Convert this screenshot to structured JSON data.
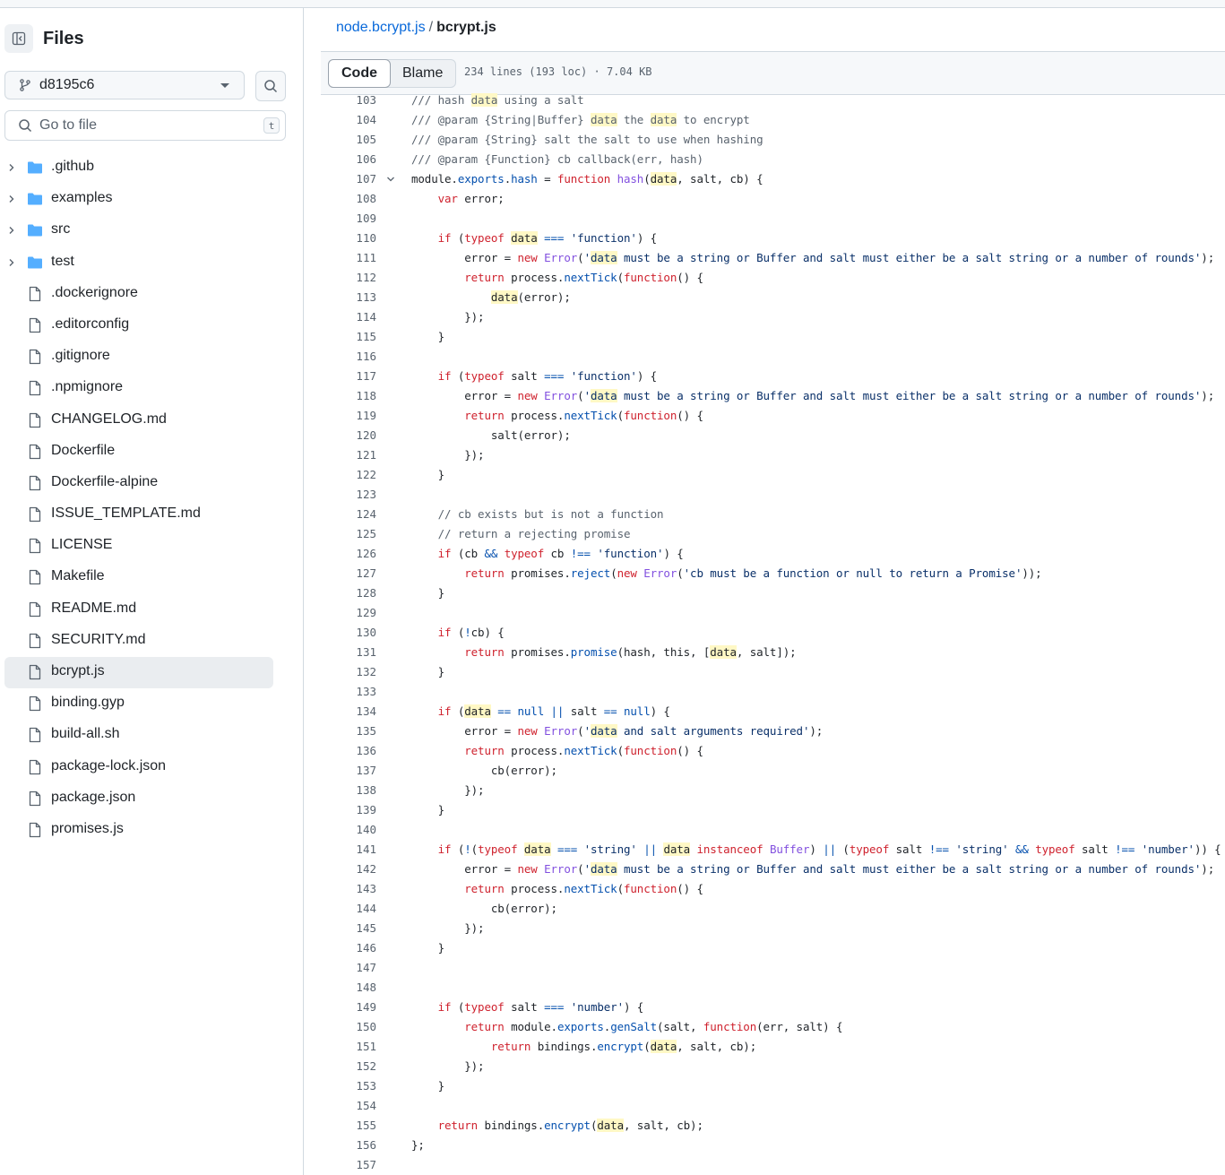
{
  "sidebar": {
    "title": "Files",
    "branch": "d8195c6",
    "goto_placeholder": "Go to file",
    "goto_shortcut": "t",
    "items": [
      {
        "name": ".github",
        "type": "folder"
      },
      {
        "name": "examples",
        "type": "folder"
      },
      {
        "name": "src",
        "type": "folder"
      },
      {
        "name": "test",
        "type": "folder"
      },
      {
        "name": ".dockerignore",
        "type": "file"
      },
      {
        "name": ".editorconfig",
        "type": "file"
      },
      {
        "name": ".gitignore",
        "type": "file"
      },
      {
        "name": ".npmignore",
        "type": "file"
      },
      {
        "name": "CHANGELOG.md",
        "type": "file"
      },
      {
        "name": "Dockerfile",
        "type": "file"
      },
      {
        "name": "Dockerfile-alpine",
        "type": "file"
      },
      {
        "name": "ISSUE_TEMPLATE.md",
        "type": "file"
      },
      {
        "name": "LICENSE",
        "type": "file"
      },
      {
        "name": "Makefile",
        "type": "file"
      },
      {
        "name": "README.md",
        "type": "file"
      },
      {
        "name": "SECURITY.md",
        "type": "file"
      },
      {
        "name": "bcrypt.js",
        "type": "file",
        "selected": true
      },
      {
        "name": "binding.gyp",
        "type": "file"
      },
      {
        "name": "build-all.sh",
        "type": "file"
      },
      {
        "name": "package-lock.json",
        "type": "file"
      },
      {
        "name": "package.json",
        "type": "file"
      },
      {
        "name": "promises.js",
        "type": "file"
      }
    ]
  },
  "breadcrumb": {
    "repo": "node.bcrypt.js",
    "separator": "/",
    "file": "bcrypt.js"
  },
  "toolbar": {
    "code_tab": "Code",
    "blame_tab": "Blame",
    "file_info": "234 lines (193 loc) · 7.04 KB"
  },
  "highlight_term": "data",
  "colors": {
    "keyword": "#cf222e",
    "function": "#8250df",
    "property": "#0550ae",
    "string": "#0a3069",
    "comment": "#59636e",
    "match_highlight": "#fff8c5",
    "link": "#0969da"
  },
  "code_lines": [
    {
      "n": 103,
      "text": "/// hash data using a salt"
    },
    {
      "n": 104,
      "text": "/// @param {String|Buffer} data the data to encrypt"
    },
    {
      "n": 105,
      "text": "/// @param {String} salt the salt to use when hashing"
    },
    {
      "n": 106,
      "text": "/// @param {Function} cb callback(err, hash)"
    },
    {
      "n": 107,
      "text": "module.exports.hash = function hash(data, salt, cb) {",
      "fold": true
    },
    {
      "n": 108,
      "text": "    var error;"
    },
    {
      "n": 109,
      "text": ""
    },
    {
      "n": 110,
      "text": "    if (typeof data === 'function') {"
    },
    {
      "n": 111,
      "text": "        error = new Error('data must be a string or Buffer and salt must either be a salt string or a number of rounds');"
    },
    {
      "n": 112,
      "text": "        return process.nextTick(function() {"
    },
    {
      "n": 113,
      "text": "            data(error);"
    },
    {
      "n": 114,
      "text": "        });"
    },
    {
      "n": 115,
      "text": "    }"
    },
    {
      "n": 116,
      "text": ""
    },
    {
      "n": 117,
      "text": "    if (typeof salt === 'function') {"
    },
    {
      "n": 118,
      "text": "        error = new Error('data must be a string or Buffer and salt must either be a salt string or a number of rounds');"
    },
    {
      "n": 119,
      "text": "        return process.nextTick(function() {"
    },
    {
      "n": 120,
      "text": "            salt(error);"
    },
    {
      "n": 121,
      "text": "        });"
    },
    {
      "n": 122,
      "text": "    }"
    },
    {
      "n": 123,
      "text": ""
    },
    {
      "n": 124,
      "text": "    // cb exists but is not a function"
    },
    {
      "n": 125,
      "text": "    // return a rejecting promise"
    },
    {
      "n": 126,
      "text": "    if (cb && typeof cb !== 'function') {"
    },
    {
      "n": 127,
      "text": "        return promises.reject(new Error('cb must be a function or null to return a Promise'));"
    },
    {
      "n": 128,
      "text": "    }"
    },
    {
      "n": 129,
      "text": ""
    },
    {
      "n": 130,
      "text": "    if (!cb) {"
    },
    {
      "n": 131,
      "text": "        return promises.promise(hash, this, [data, salt]);"
    },
    {
      "n": 132,
      "text": "    }"
    },
    {
      "n": 133,
      "text": ""
    },
    {
      "n": 134,
      "text": "    if (data == null || salt == null) {"
    },
    {
      "n": 135,
      "text": "        error = new Error('data and salt arguments required');"
    },
    {
      "n": 136,
      "text": "        return process.nextTick(function() {"
    },
    {
      "n": 137,
      "text": "            cb(error);"
    },
    {
      "n": 138,
      "text": "        });"
    },
    {
      "n": 139,
      "text": "    }"
    },
    {
      "n": 140,
      "text": ""
    },
    {
      "n": 141,
      "text": "    if (!(typeof data === 'string' || data instanceof Buffer) || (typeof salt !== 'string' && typeof salt !== 'number')) {"
    },
    {
      "n": 142,
      "text": "        error = new Error('data must be a string or Buffer and salt must either be a salt string or a number of rounds');"
    },
    {
      "n": 143,
      "text": "        return process.nextTick(function() {"
    },
    {
      "n": 144,
      "text": "            cb(error);"
    },
    {
      "n": 145,
      "text": "        });"
    },
    {
      "n": 146,
      "text": "    }"
    },
    {
      "n": 147,
      "text": ""
    },
    {
      "n": 148,
      "text": ""
    },
    {
      "n": 149,
      "text": "    if (typeof salt === 'number') {"
    },
    {
      "n": 150,
      "text": "        return module.exports.genSalt(salt, function(err, salt) {"
    },
    {
      "n": 151,
      "text": "            return bindings.encrypt(data, salt, cb);"
    },
    {
      "n": 152,
      "text": "        });"
    },
    {
      "n": 153,
      "text": "    }"
    },
    {
      "n": 154,
      "text": ""
    },
    {
      "n": 155,
      "text": "    return bindings.encrypt(data, salt, cb);"
    },
    {
      "n": 156,
      "text": "};"
    },
    {
      "n": 157,
      "text": ""
    }
  ]
}
